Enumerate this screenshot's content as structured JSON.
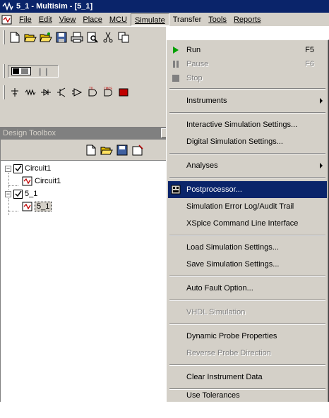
{
  "window": {
    "title": "5_1 - Multisim - [5_1]"
  },
  "menubar": {
    "items": [
      "File",
      "Edit",
      "View",
      "Place",
      "MCU",
      "Simulate",
      "Transfer",
      "Tools",
      "Reports"
    ]
  },
  "toolbox": {
    "title": "Design Toolbox",
    "tree": [
      {
        "label": "Circuit1"
      },
      {
        "label": "Circuit1"
      },
      {
        "label": "5_1"
      },
      {
        "label": "5_1"
      }
    ]
  },
  "simulate_menu": {
    "run": {
      "label": "Run",
      "shortcut": "F5"
    },
    "pause": {
      "label": "Pause",
      "shortcut": "F6"
    },
    "stop": {
      "label": "Stop"
    },
    "instruments": "Instruments",
    "interactive_settings": "Interactive Simulation Settings...",
    "digital_settings": "Digital Simulation Settings...",
    "analyses": "Analyses",
    "postprocessor": "Postprocessor...",
    "error_log": "Simulation Error Log/Audit Trail",
    "xspice": "XSpice Command Line Interface",
    "load_settings": "Load Simulation Settings...",
    "save_settings": "Save Simulation Settings...",
    "auto_fault": "Auto Fault Option...",
    "vhdl": "VHDL Simulation",
    "dynamic_probe": "Dynamic Probe Properties",
    "reverse_probe": "Reverse Probe Direction",
    "clear_instrument": "Clear Instrument Data",
    "use_tolerances": "Use Tolerances"
  },
  "colors": {
    "titlebar": "#0a246a",
    "face": "#d4d0c8",
    "highlight": "#0a246a",
    "run_icon": "#00a000"
  },
  "icons": {
    "toolbar1": [
      "new-icon",
      "open-icon",
      "open-folder-icon",
      "save-icon",
      "print-icon",
      "print-preview-icon",
      "cut-icon",
      "copy-icon"
    ],
    "toolbar3": [
      "source-icon",
      "basic-icon",
      "diode-icon",
      "transistor-icon",
      "analog-icon",
      "ttl-icon",
      "cmos-icon",
      "misc-digital-icon"
    ]
  }
}
